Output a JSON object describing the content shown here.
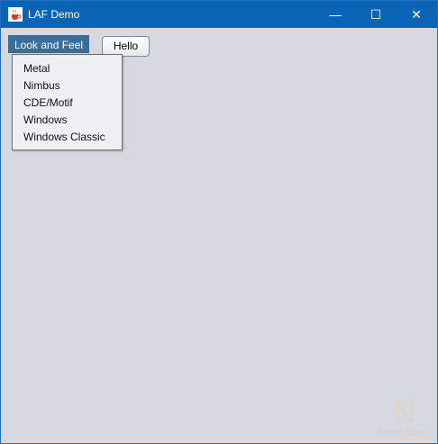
{
  "window": {
    "title": "LAF Demo",
    "controls": {
      "minimize": "—",
      "maximize": "☐",
      "close": "✕"
    }
  },
  "menubar": {
    "menu_label": "Look and Feel",
    "hello_button": "Hello"
  },
  "dropdown": {
    "items": [
      "Metal",
      "Nimbus",
      "CDE/Motif",
      "Windows",
      "Windows Classic"
    ]
  },
  "watermark": {
    "text_a": "Kode",
    "text_b": "Java"
  },
  "colors": {
    "titlebar": "#0a64b4",
    "menu_highlight": "#3a6d97",
    "content_bg": "#d6d9df",
    "dropdown_bg": "#eef0f4"
  }
}
